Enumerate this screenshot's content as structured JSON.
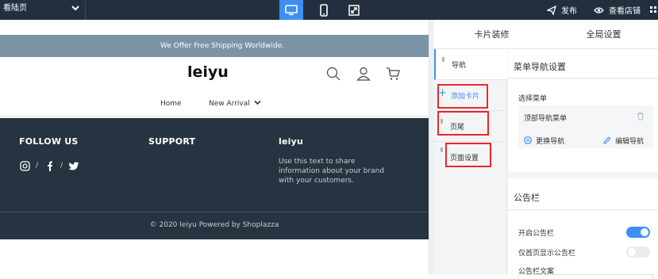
{
  "topbar": {
    "page_select_value": "看陆页",
    "publish_label": "发布",
    "view_store_label": "查看店铺",
    "colors": {
      "bar_bg": "#232f3e",
      "active_device": "#3d8ff2"
    }
  },
  "preview": {
    "announcement": "We Offer Free Shipping Worldwide.",
    "logo": "leiyu",
    "nav": {
      "home": "Home",
      "new_arrival": "New Arrival"
    },
    "footer": {
      "follow_us": "FOLLOW US",
      "support": "SUPPORT",
      "brand_heading": "leiyu",
      "brand_text": "Use this text to share information about your brand with your customers.",
      "copyright": "© 2020 leiyu   Powered by Shoplazza"
    }
  },
  "panel": {
    "tabs": {
      "card_decoration": "卡片装修",
      "global_settings": "全局设置"
    },
    "cards": {
      "nav": "导航",
      "add_card": "添加卡片",
      "footer": "页尾",
      "page_settings": "页面设置"
    },
    "menu_nav_settings": {
      "title": "菜单导航设置",
      "select_menu_label": "选择菜单",
      "selected_menu": "顶部导航菜单",
      "change_nav": "更换导航",
      "edit_nav": "编辑导航"
    },
    "announcement_bar": {
      "title": "公告栏",
      "enable_label": "开启公告栏",
      "enable_on": true,
      "homepage_only_label": "仅首页显示公告栏",
      "homepage_only_on": false,
      "text_label": "公告栏文案"
    }
  }
}
